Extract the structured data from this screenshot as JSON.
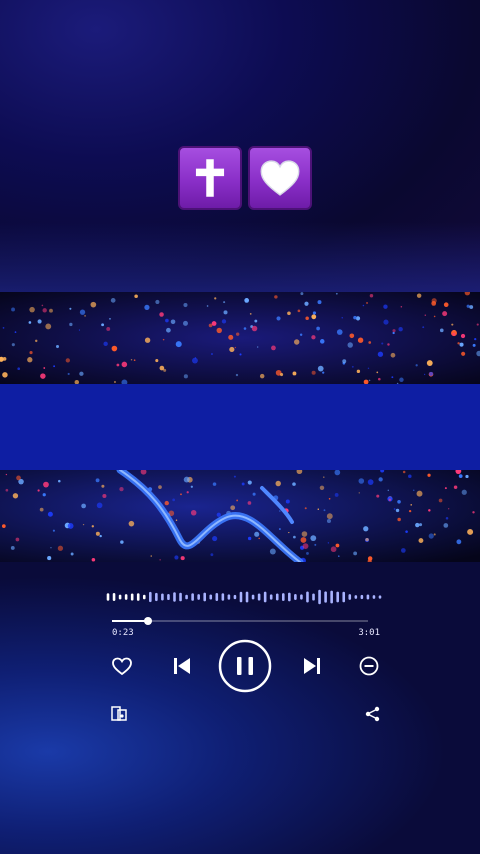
{
  "emojis": [
    "latin-cross-emoji",
    "white-heart-emoji"
  ],
  "player": {
    "current_time": "0:23",
    "total_time": "3:01",
    "progress": 0.14,
    "state": "playing"
  },
  "colors": {
    "emoji_tile": "#9a3fd6",
    "band": "#0e1ea3",
    "controls": "#ffffff",
    "waveform_played": "#ffffff",
    "waveform_unplayed": "#a9b3ff"
  },
  "icons": {
    "like": "heart-outline-icon",
    "previous": "skip-previous-icon",
    "pause": "pause-icon",
    "next": "skip-next-icon",
    "remove": "minus-circle-icon",
    "devices": "connect-device-icon",
    "share": "share-icon"
  }
}
